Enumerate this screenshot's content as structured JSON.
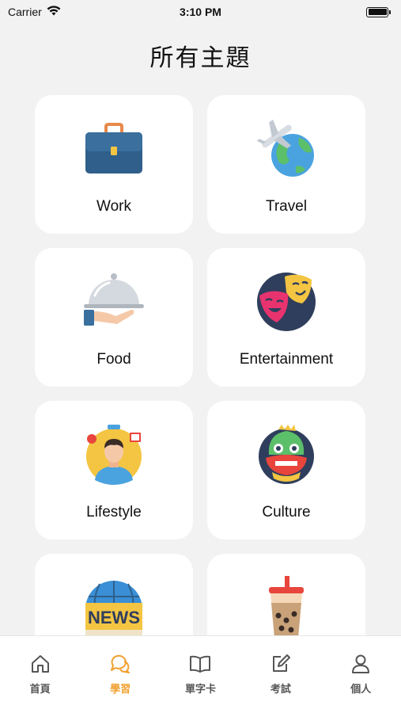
{
  "status_bar": {
    "carrier": "Carrier",
    "time": "3:10 PM",
    "icons": [
      "wifi-icon",
      "battery-icon"
    ]
  },
  "page": {
    "title": "所有主題"
  },
  "topics": [
    {
      "label": "Work",
      "icon": "briefcase-icon"
    },
    {
      "label": "Travel",
      "icon": "airplane-globe-icon"
    },
    {
      "label": "Food",
      "icon": "food-cloche-icon"
    },
    {
      "label": "Entertainment",
      "icon": "theater-masks-icon"
    },
    {
      "label": "Lifestyle",
      "icon": "person-lifestyle-icon"
    },
    {
      "label": "Culture",
      "icon": "lion-dance-icon"
    },
    {
      "label": "",
      "icon": "news-globe-icon"
    },
    {
      "label": "",
      "icon": "bubble-tea-icon"
    }
  ],
  "tab_bar": {
    "active_color": "#f0a030",
    "inactive_color": "#555555",
    "items": [
      {
        "label": "首頁",
        "icon": "home-icon",
        "active": false
      },
      {
        "label": "學習",
        "icon": "chat-bubbles-icon",
        "active": true
      },
      {
        "label": "單字卡",
        "icon": "book-icon",
        "active": false
      },
      {
        "label": "考試",
        "icon": "edit-icon",
        "active": false
      },
      {
        "label": "個人",
        "icon": "user-icon",
        "active": false
      }
    ]
  }
}
